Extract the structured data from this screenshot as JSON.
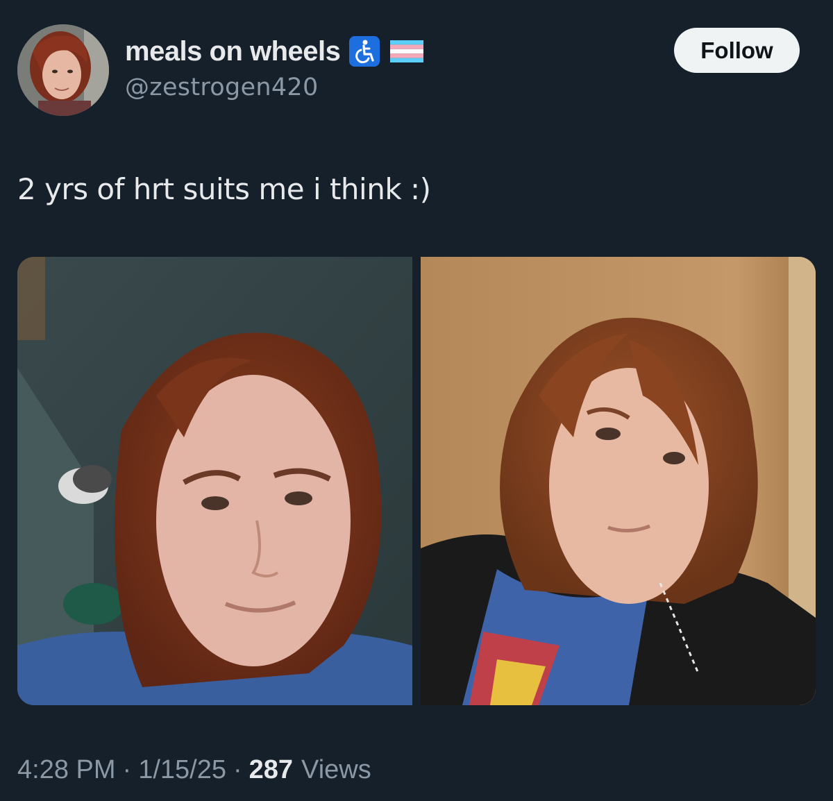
{
  "author": {
    "display_name": "meals on wheels",
    "handle": "@zestrogen420",
    "badges": [
      "wheelchair-emoji",
      "transgender-flag-emoji"
    ]
  },
  "follow_button": {
    "label": "Follow"
  },
  "tweet": {
    "text": "2 yrs of hrt suits me i think :)"
  },
  "media": [
    {
      "icon": "photo-before"
    },
    {
      "icon": "photo-after"
    }
  ],
  "meta": {
    "time": "4:28 PM",
    "separator": "·",
    "date": "1/15/25",
    "views_count": "287",
    "views_label": "Views"
  },
  "colors": {
    "background": "#15202b",
    "text_primary": "#e7e9ea",
    "text_secondary": "#8b98a5",
    "follow_bg": "#eff3f4",
    "follow_text": "#0f1419",
    "wheelchair_blue": "#1d6fe0",
    "flag_blue": "#5bcefa",
    "flag_pink": "#f5a9b8"
  }
}
